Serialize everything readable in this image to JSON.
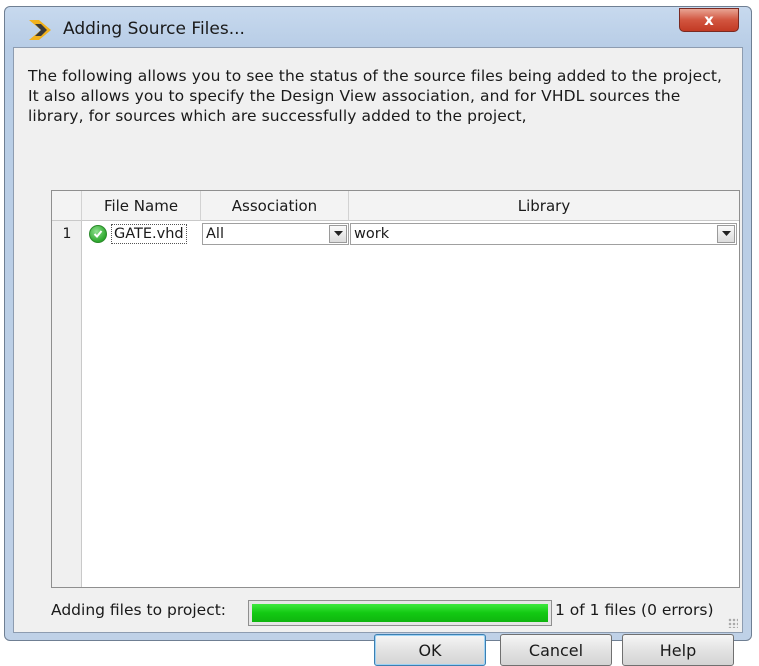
{
  "window": {
    "title": "Adding Source Files...",
    "close_glyph": "x"
  },
  "description": "The following allows you to see the status of the source files being added to the project, It also allows you to specify the Design View association, and for VHDL sources the library, for sources which are successfully added to the project,",
  "table": {
    "columns": [
      "File Name",
      "Association",
      "Library"
    ],
    "rows": [
      {
        "number": "1",
        "status_icon": "check-icon",
        "file_name": "GATE.vhd",
        "association": "All",
        "library": "work"
      }
    ]
  },
  "progress": {
    "label": "Adding files to project:",
    "value": 1.0,
    "status_text": "1 of 1 files (0 errors)",
    "fill_color": "#12c912"
  },
  "buttons": {
    "ok": "OK",
    "cancel": "Cancel",
    "help": "Help"
  },
  "colors": {
    "close_button": "#d2553f",
    "dialog_frame": "#bfd1e7",
    "dialog_client": "#f0f0f0"
  }
}
